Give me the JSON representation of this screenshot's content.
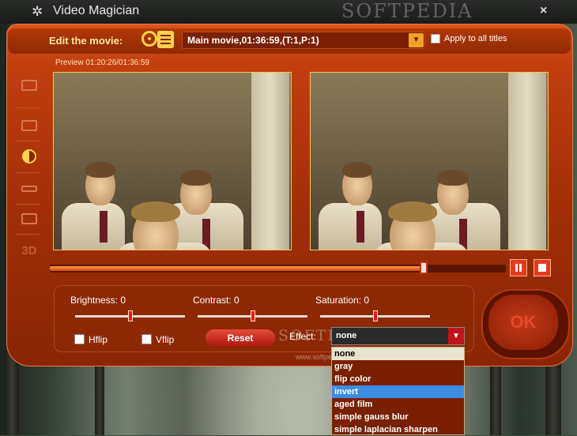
{
  "window": {
    "title": "Video Magician",
    "close": "×",
    "icon": "sparkle-icon"
  },
  "watermark": {
    "top": "SOFTPEDIA",
    "middle": "SOFTPEDIA",
    "url": "www.softpedia.com"
  },
  "header": {
    "edit_label": "Edit the movie:",
    "movie_value": "Main movie,01:36:59,(T:1,P:1)",
    "apply_label": "Apply to all titles"
  },
  "preview": {
    "label": "Preview 01:20:26/01:36:59"
  },
  "timeline": {
    "position_fraction": 0.82
  },
  "adjustments": {
    "brightness_label": "Brightness: 0",
    "contrast_label": "Contrast: 0",
    "saturation_label": "Saturation: 0",
    "brightness_value": 0,
    "contrast_value": 0,
    "saturation_value": 0,
    "hflip_label": "Hflip",
    "vflip_label": "Vflip",
    "reset_label": "Reset",
    "effect_label": "Effect:",
    "effect_value": "none"
  },
  "ok_label": "OK",
  "effect_options": [
    "none",
    "gray",
    "flip color",
    "invert",
    "aged film",
    "simple gauss blur",
    "simple laplacian sharpen"
  ],
  "colors": {
    "accent": "#c23e10",
    "highlight": "#3a8de0",
    "title_text": "#ffe79a"
  }
}
